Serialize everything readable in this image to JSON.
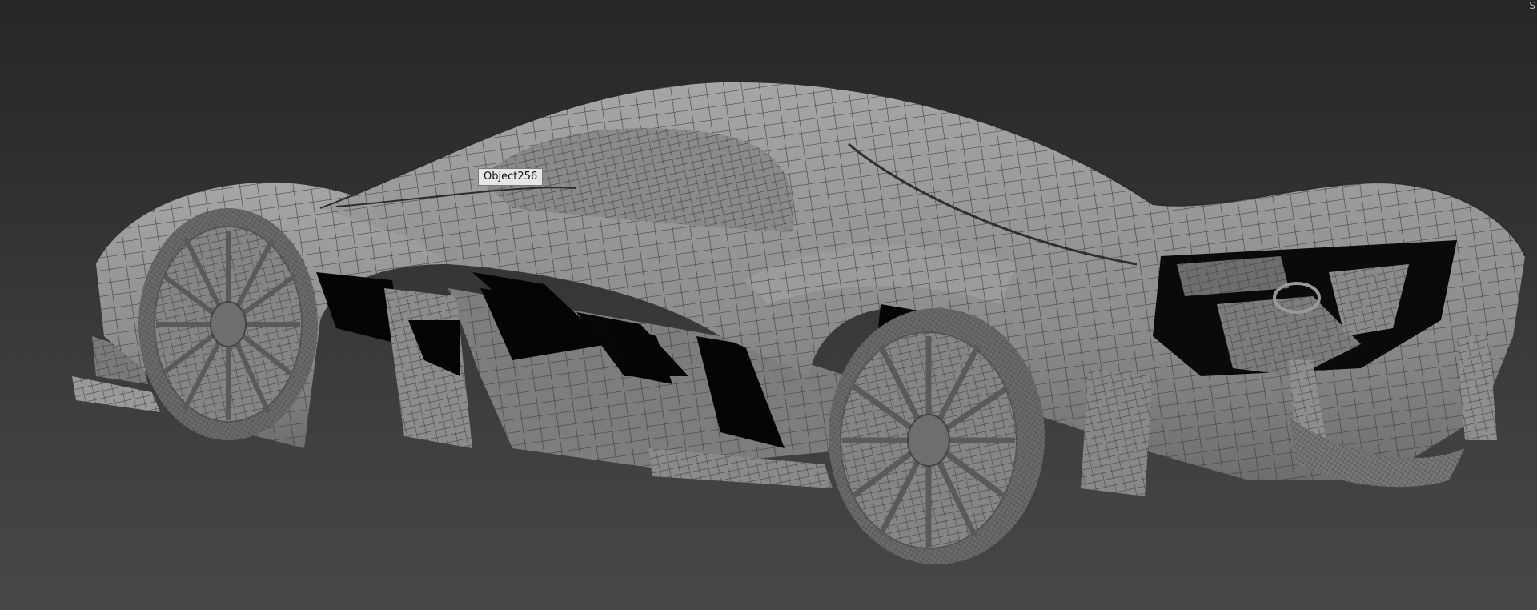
{
  "viewport": {
    "tooltip_label": "Object256",
    "corner_glyph": "S"
  },
  "colors": {
    "background_top": "#262626",
    "background_bottom": "#474747",
    "mesh_fill": "#8f8f8f",
    "mesh_wire": "#3a3a3a",
    "shadow": "#050505"
  }
}
